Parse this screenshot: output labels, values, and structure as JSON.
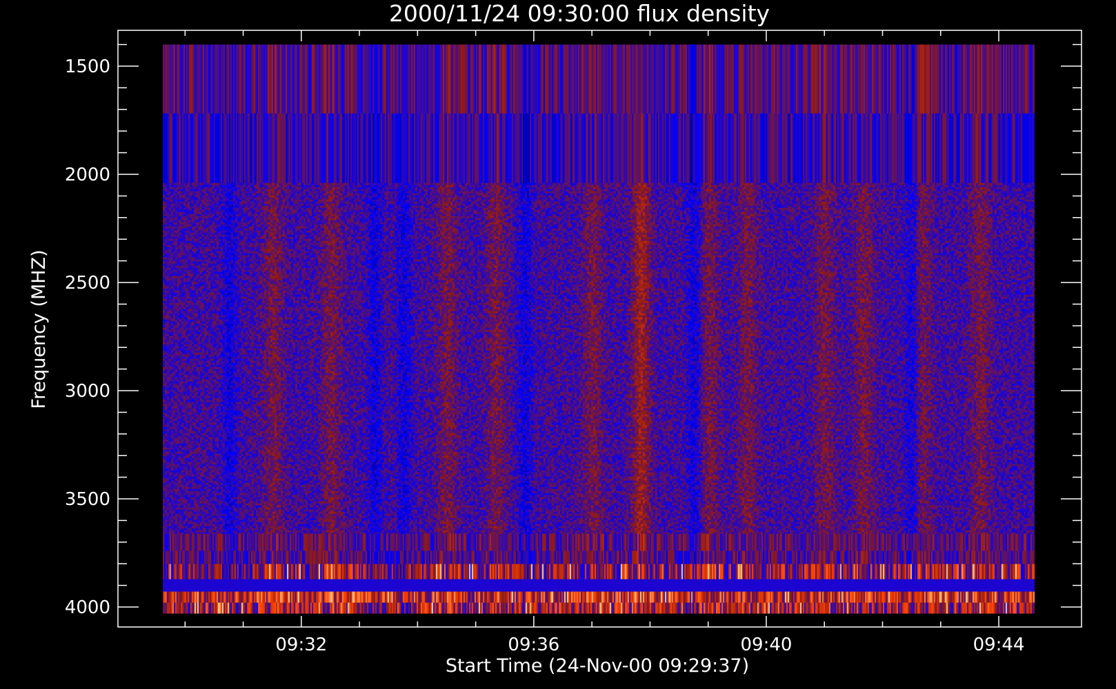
{
  "chart_data": {
    "type": "heatmap",
    "title": "2000/11/24 09:30:00 flux density",
    "xlabel": "Start Time (24-Nov-00 09:29:37)",
    "ylabel": "Frequency (MHZ)",
    "x_range": [
      "09:29:37",
      "09:44:37"
    ],
    "y_range_mhz": [
      1400,
      4030
    ],
    "y_axis_inverted": true,
    "x_ticks": [
      "09:32",
      "09:36",
      "09:40",
      "09:44"
    ],
    "y_ticks": [
      1500,
      2000,
      2500,
      3000,
      3500,
      4000
    ],
    "colormap": [
      "#000000",
      "#0000ff",
      "#8c1a1a",
      "#ff4000",
      "#ffd090"
    ],
    "frequency_bands_mhz": [
      {
        "from": 1400,
        "to": 1720,
        "texture": "vertical streaks",
        "level": 0.38
      },
      {
        "from": 1720,
        "to": 2040,
        "texture": "vertical streaks",
        "level": 0.33
      },
      {
        "from": 2040,
        "to": 3660,
        "texture": "noise",
        "level": 0.36
      },
      {
        "from": 3660,
        "to": 3740,
        "texture": "vertical streaks",
        "level": 0.4
      },
      {
        "from": 3740,
        "to": 3800,
        "texture": "vertical streaks",
        "level": 0.38
      },
      {
        "from": 3800,
        "to": 3870,
        "texture": "bright streaks",
        "level": 0.5
      },
      {
        "from": 3870,
        "to": 3930,
        "texture": "uniform",
        "level": 0.3
      },
      {
        "from": 3930,
        "to": 3980,
        "texture": "bright streaks",
        "level": 0.62
      },
      {
        "from": 3980,
        "to": 4030,
        "texture": "bright streaks",
        "level": 0.52
      }
    ],
    "enhanced_intervals": [
      "09:31:30",
      "09:32:30",
      "09:34:30",
      "09:35:20",
      "09:37:00",
      "09:37:50",
      "09:39:00",
      "09:39:40",
      "09:41:00",
      "09:41:40",
      "09:42:40",
      "09:43:40"
    ],
    "strongest_interval": "09:37:50",
    "quiet_intervals": [
      "09:30:45",
      "09:33:15",
      "09:33:45",
      "09:35:50",
      "09:38:45",
      "09:42:30"
    ]
  }
}
